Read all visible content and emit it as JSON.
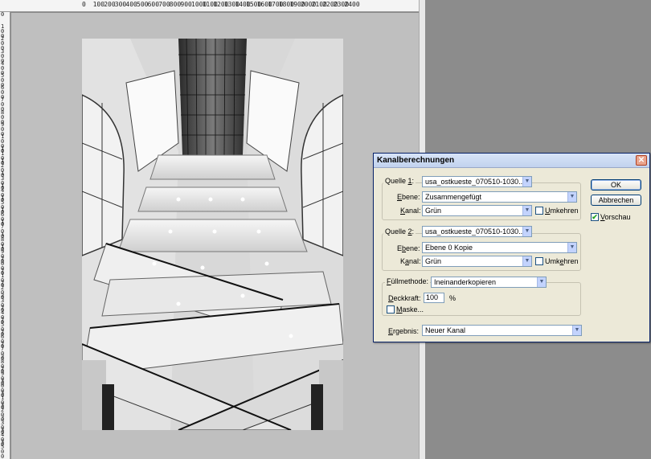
{
  "ruler": {
    "top_labels": [
      "0",
      "100",
      "200",
      "300",
      "400",
      "500",
      "600",
      "700",
      "800",
      "900",
      "1000",
      "1100",
      "1200",
      "1300",
      "1400",
      "1500",
      "1600",
      "1700",
      "1800",
      "1900",
      "2000",
      "2100",
      "2200",
      "2300",
      "2400"
    ],
    "left_labels": [
      "0",
      "100",
      "200",
      "300",
      "400",
      "500",
      "600",
      "700",
      "800",
      "900",
      "1000",
      "1100",
      "1200",
      "1300",
      "1400",
      "1500",
      "1600",
      "1700",
      "1800",
      "1900",
      "2000",
      "2100",
      "2200",
      "2300",
      "2400",
      "2500",
      "2600",
      "2700",
      "2800",
      "2900",
      "3000",
      "3100",
      "3200",
      "3300",
      "3400",
      "3500"
    ]
  },
  "dialog": {
    "title": "Kanalberechnungen",
    "close_symbol": "✕",
    "source1": {
      "legend_prefix": "Quelle ",
      "legend_key": "1",
      "legend_suffix": ":",
      "file": "usa_ostkueste_070510-1030....",
      "layer_label_key": "E",
      "layer_label_rest": "bene:",
      "layer": "Zusammengefügt",
      "channel_label_key": "K",
      "channel_label_rest": "anal:",
      "channel": "Grün",
      "invert_key": "U",
      "invert_rest": "mkehren"
    },
    "source2": {
      "legend_prefix": "Quelle ",
      "legend_key": "2",
      "legend_suffix": ":",
      "file": "usa_ostkueste_070510-1030....",
      "layer_label_pre": "E",
      "layer_label_key": "b",
      "layer_label_rest": "ene:",
      "layer": "Ebene 0 Kopie",
      "channel_label_pre": "K",
      "channel_label_key": "a",
      "channel_label_rest": "nal:",
      "channel": "Grün",
      "invert_pre": "Umk",
      "invert_key": "e",
      "invert_rest": "hren"
    },
    "blend": {
      "label_key": "F",
      "label_rest": "üllmethode:",
      "mode": "Ineinanderkopieren",
      "opacity_label_key": "D",
      "opacity_label_rest": "eckkraft:",
      "opacity_value": "100",
      "opacity_unit": "%",
      "mask_key": "M",
      "mask_rest": "aske..."
    },
    "result": {
      "label_key": "E",
      "label_rest": "rgebnis:",
      "value": "Neuer Kanal"
    },
    "buttons": {
      "ok": "OK",
      "cancel": "Abbrechen",
      "preview_key": "V",
      "preview_rest": "orschau",
      "preview_checked": "✔"
    },
    "arrow": "▼"
  }
}
